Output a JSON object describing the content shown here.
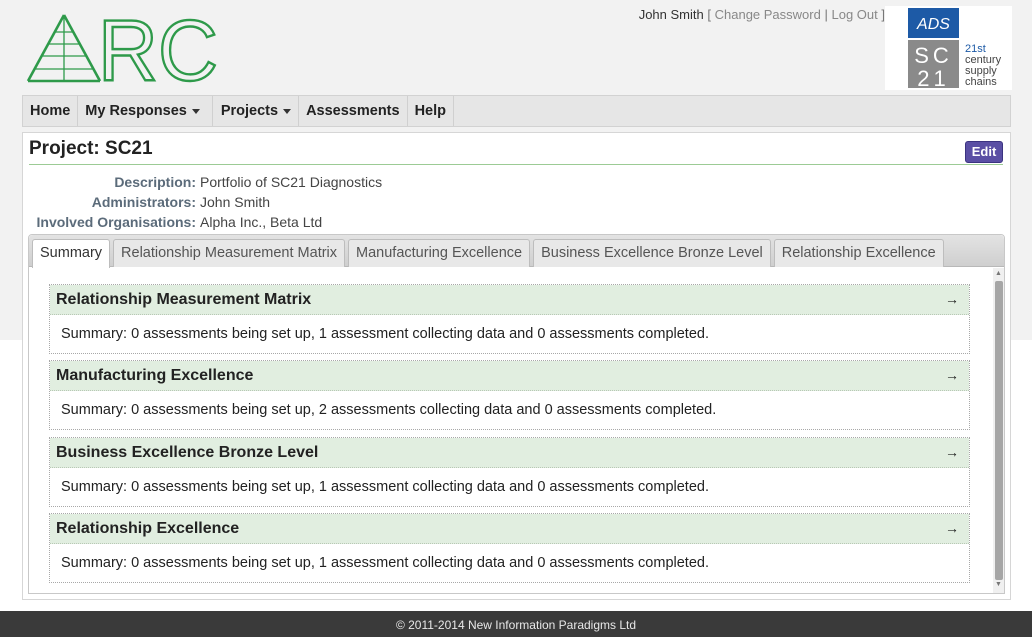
{
  "header": {
    "logo_text": "ARC",
    "user_name": "John Smith",
    "bracket_open": "[",
    "change_password": "Change Password",
    "separator": "|",
    "log_out": "Log Out",
    "bracket_close": "]",
    "partner_logo": {
      "ads_text": "ADS",
      "sc_text": "SC",
      "num_text": "21",
      "tagline": [
        "21st",
        "century",
        "supply",
        "chains"
      ]
    }
  },
  "nav": {
    "items": [
      {
        "label": "Home",
        "dropdown": false
      },
      {
        "label": "My Responses",
        "dropdown": true
      },
      {
        "label": "Projects",
        "dropdown": true
      },
      {
        "label": "Assessments",
        "dropdown": false
      },
      {
        "label": "Help",
        "dropdown": false
      }
    ]
  },
  "project": {
    "title": "Project: SC21",
    "edit_label": "Edit",
    "meta": [
      {
        "label": "Description:",
        "value": "Portfolio of SC21 Diagnostics"
      },
      {
        "label": "Administrators:",
        "value": "John Smith"
      },
      {
        "label": "Involved Organisations:",
        "value": "Alpha Inc., Beta Ltd"
      }
    ]
  },
  "tabs": [
    {
      "label": "Summary",
      "active": true
    },
    {
      "label": "Relationship Measurement Matrix",
      "active": false
    },
    {
      "label": "Manufacturing Excellence",
      "active": false
    },
    {
      "label": "Business Excellence Bronze Level",
      "active": false
    },
    {
      "label": "Relationship Excellence",
      "active": false
    }
  ],
  "sections": [
    {
      "title": "Relationship Measurement Matrix",
      "summary": "Summary: 0 assessments being set up, 1 assessment collecting data and 0 assessments completed."
    },
    {
      "title": "Manufacturing Excellence",
      "summary": "Summary: 0 assessments being set up, 2 assessments collecting data and 0 assessments completed."
    },
    {
      "title": "Business Excellence Bronze Level",
      "summary": "Summary: 0 assessments being set up, 1 assessment collecting data and 0 assessments completed."
    },
    {
      "title": "Relationship Excellence",
      "summary": "Summary: 0 assessments being set up, 1 assessment collecting data and 0 assessments completed."
    }
  ],
  "section_arrow": "→",
  "footer": {
    "text": "© 2011-2014 New Information Paradigms Ltd"
  },
  "colors": {
    "brand_green": "#2e9a4a",
    "edit_button": "#5a4fa4",
    "section_header_bg": "#e1eee0",
    "footer_bg": "#3a3a3a",
    "ads_blue": "#1d5aa6"
  }
}
